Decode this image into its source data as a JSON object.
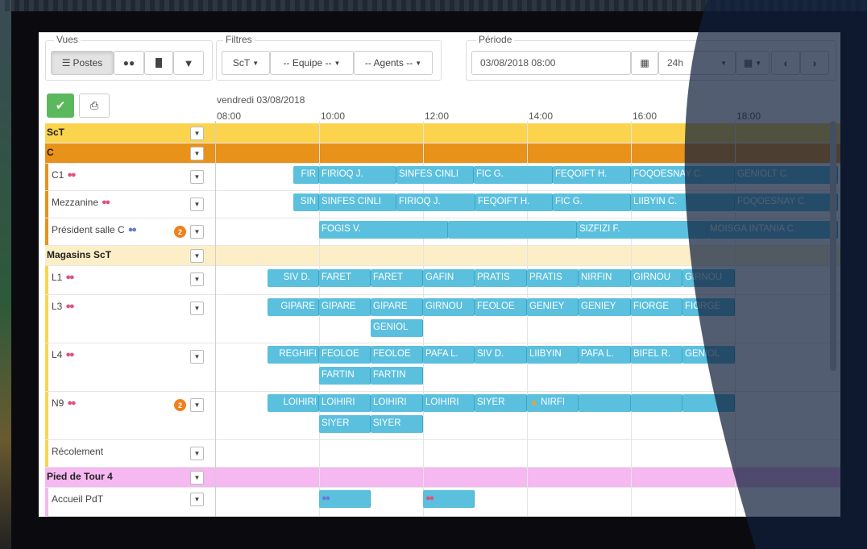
{
  "toolbar": {
    "views_legend": "Vues",
    "postes_label": "Postes",
    "filters_legend": "Filtres",
    "filter_sct": "ScT",
    "filter_team": "-- Equipe --",
    "filter_agents": "-- Agents --",
    "period_legend": "Période",
    "period_value": "03/08/2018 08:00",
    "duration_value": "24h"
  },
  "timeline": {
    "date": "vendredi 03/08/2018",
    "ticks": [
      "08:00",
      "10:00",
      "12:00",
      "14:00",
      "16:00",
      "18:00"
    ]
  },
  "rows": {
    "sct": "ScT",
    "c": "C",
    "c1": "C1",
    "mezzanine": "Mezzanine",
    "president": "Président salle C",
    "president_badge": "2",
    "magasins": "Magasins ScT",
    "l1": "L1",
    "l3": "L3",
    "l4": "L4",
    "n9": "N9",
    "n9_badge": "2",
    "recolement": "Récolement",
    "pied": "Pied de Tour 4",
    "accueil": "Accueil PdT"
  },
  "chips": {
    "c1": [
      "FIR",
      "FIRIOQ J.",
      "SINFES CINLI",
      "FIC G.",
      "FEQOIFT H.",
      "FOQOESNAY C.",
      "GENIOLT C."
    ],
    "mezzanine": [
      "SIN",
      "SINFES CINLI",
      "FIRIOQ J.",
      "FEQOIFT H.",
      "FIC G.",
      "LIIBYIN C.",
      "FOQOESNAY C."
    ],
    "president": [
      "FOGIS V.",
      "",
      "SIZFIZI F.",
      "MOISGA INTANIA C."
    ],
    "l1": [
      "SIV D.",
      "FARET",
      "FARET",
      "GAFIN",
      "PRATIS",
      "PRATIS",
      "NIRFIN",
      "GIRNOU",
      "GIRNOU"
    ],
    "l3": [
      "GIPARE",
      "GIPARE",
      "GIPARE",
      "GIRNOU",
      "FEOLOE",
      "GENIEY",
      "GENIEY",
      "FIORGE",
      "FIORGE"
    ],
    "l3b": [
      "GENIOL"
    ],
    "l4": [
      "REGHIFI",
      "FEOLOE",
      "FEOLOE",
      "PAFA L.",
      "SIV D.",
      "LIIBYIN",
      "PAFA L.",
      "BIFEL R.",
      "GENIOL"
    ],
    "l4b": [
      "FARTIN",
      "FARTIN"
    ],
    "n9": [
      "LOIHIRI",
      "LOIHIRI",
      "LOIHIRI",
      "LOIHIRI",
      "SIYER",
      "NIRFI",
      "",
      "",
      ""
    ],
    "n9b": [
      "SIYER",
      "SIYER"
    ]
  },
  "colors": {
    "sct_band": "#fcd34d",
    "c_band": "#e8921a",
    "magasins_band": "#fcefc7",
    "pied_band": "#f5b8f0",
    "chip": "#5bc0de",
    "ok": "#5cb85c",
    "overlay": "#0f1e3c"
  }
}
